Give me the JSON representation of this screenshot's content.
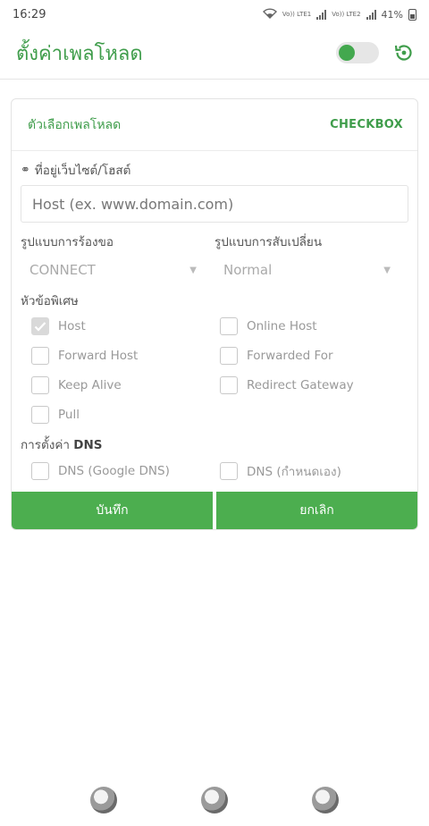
{
  "status_bar": {
    "time": "16:29",
    "battery": "41%",
    "sim1": "Vo)) LTE1",
    "sim2": "Vo)) LTE2"
  },
  "app_bar": {
    "title": "ตั้งค่าเพลโหลด",
    "toggle_on": false
  },
  "card": {
    "title": "ตัวเลือกเพลโหลด",
    "mode": "CHECKBOX",
    "host": {
      "label": "ที่อยู่เว็บไซต์/โฮสต์",
      "placeholder": "Host (ex. www.domain.com)"
    },
    "request_method": {
      "label": "รูปแบบการร้องขอ",
      "value": "CONNECT"
    },
    "injection_method": {
      "label": "รูปแบบการสับเปลี่ยน",
      "value": "Normal"
    },
    "headers_label": "หัวข้อพิเศษ",
    "headers": [
      {
        "label": "Host",
        "checked": true
      },
      {
        "label": "Online Host",
        "checked": false
      },
      {
        "label": "Forward Host",
        "checked": false
      },
      {
        "label": "Forwarded For",
        "checked": false
      },
      {
        "label": "Keep Alive",
        "checked": false
      },
      {
        "label": "Redirect Gateway",
        "checked": false
      },
      {
        "label": "Pull",
        "checked": false
      }
    ],
    "dns_label_prefix": "การตั้งค่า",
    "dns_label_bold": "DNS",
    "dns": [
      {
        "label": "DNS (Google DNS)",
        "checked": false
      },
      {
        "label": "DNS (กำหนดเอง)",
        "checked": false
      }
    ],
    "save_label": "บันทึก",
    "cancel_label": "ยกเลิก"
  }
}
